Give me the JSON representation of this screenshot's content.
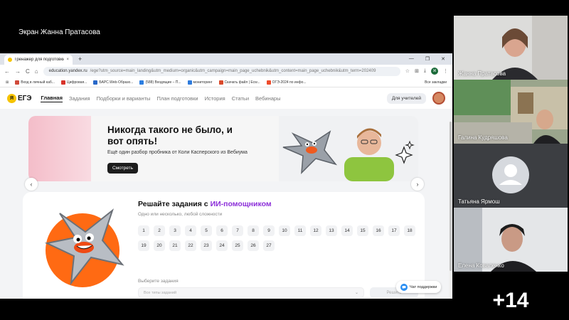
{
  "share_title": "Экран Жанна Пратасова",
  "browser": {
    "tab_title": "Тренажер для подготовки к ЕГЭ",
    "tab_close": "×",
    "new_tab": "+",
    "win_minimize": "—",
    "win_maximize": "❐",
    "win_close": "✕",
    "nav_back": "←",
    "nav_forward": "→",
    "nav_reload": "C",
    "nav_home": "⌂",
    "url_domain": "education.yandex.ru",
    "url_rest": "/ege?utm_source=main_landing&utm_medium=organic&utm_campaign=main_page_uchebnik&utm_content=main_page_uchebnik&utm_term=202409",
    "profile_letter": "Ж",
    "bookmarks": [
      {
        "label": "Вход в личный каб...",
        "color": "#d04a3a"
      },
      {
        "label": "Цифровая...",
        "color": "#d8332a"
      },
      {
        "label": "БАРС.Web-Образо...",
        "color": "#2868c8"
      },
      {
        "label": "(588) Входящие – П...",
        "color": "#2b7de0"
      },
      {
        "label": "мониторинг",
        "color": "#2e7bdc"
      },
      {
        "label": "Скачать файл | Ecw...",
        "color": "#d94a2b"
      },
      {
        "label": "ОГЭ-2024 по инфо...",
        "color": "#ee4c2c"
      }
    ],
    "bookmarks_folder": "Все закладки"
  },
  "site": {
    "logo_text": "ЕГЭ",
    "nav": [
      "Главная",
      "Задания",
      "Подборки и варианты",
      "План подготовки",
      "История",
      "Статьи",
      "Вебинары"
    ],
    "teacher_button": "Для учителей",
    "banner": {
      "title": "Никогда такого не было, и вот опять!",
      "subtitle": "Ещё один разбор пробника от Коли Касперского из Вебиума",
      "button": "Смотреть"
    },
    "arrow_left": "‹",
    "arrow_right": "›",
    "card": {
      "title_prefix": "Решайте задания с ",
      "title_highlight": "ИИ-помощником",
      "subtitle": "Одно или несколько, любой сложности",
      "numbers": [
        "1",
        "2",
        "3",
        "4",
        "5",
        "6",
        "7",
        "8",
        "9",
        "10",
        "11",
        "12",
        "13",
        "14",
        "15",
        "16",
        "17",
        "18",
        "19",
        "20",
        "21",
        "22",
        "23",
        "24",
        "25",
        "26",
        "27"
      ],
      "pick_label": "Выберите задания",
      "select_placeholder": "Все типы заданий",
      "select_chevron": "⌄",
      "solve_button": "Решить"
    },
    "support_button": "Чат поддержки"
  },
  "participants": [
    {
      "name": "Жанна Пратасова",
      "bg": "#6f6a66"
    },
    {
      "name": "Галина Кудряшова",
      "bg": "#7a8a70"
    },
    {
      "name": "Татьяна Ярмош",
      "bg": "#3c3e42"
    },
    {
      "name": "Елена Коваленко",
      "bg": "#8a8f94"
    }
  ],
  "more_participants": "+14",
  "colors": {
    "accent_purple": "#8c2fd9",
    "logo_yellow": "#f6c300",
    "banner_pink": "#f4bdc9"
  }
}
